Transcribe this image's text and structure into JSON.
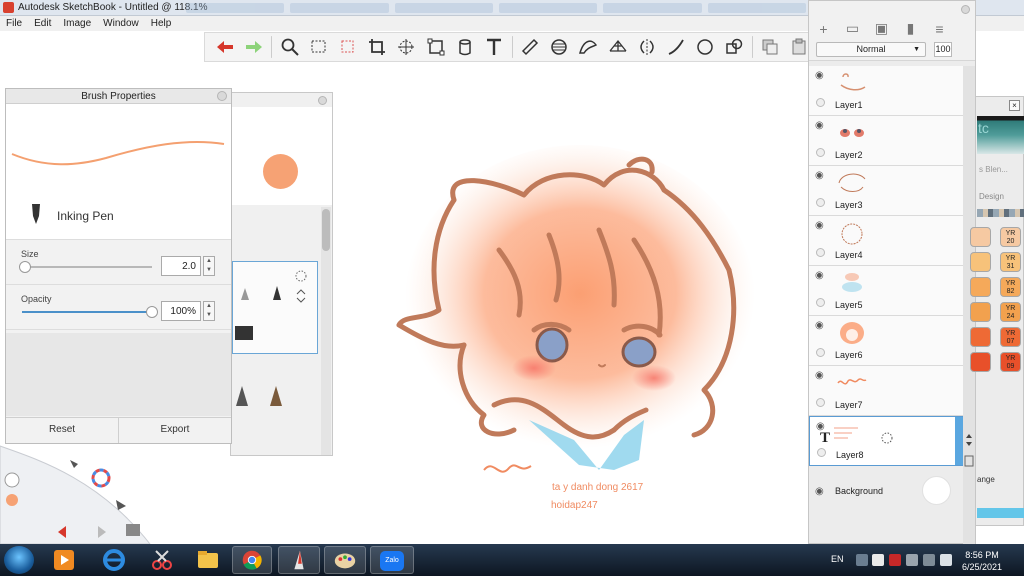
{
  "window": {
    "title": "Autodesk SketchBook - Untitled @ 118.1%"
  },
  "menu": [
    "File",
    "Edit",
    "Image",
    "Window",
    "Help"
  ],
  "toolbar": {
    "tools": [
      "undo-icon",
      "redo-icon",
      "zoom-icon",
      "rect-select-icon",
      "lasso-select-icon",
      "crop-icon",
      "transform-icon",
      "distort-icon",
      "fill-icon",
      "text-icon",
      "ruler-icon",
      "ellipse-guide-icon",
      "french-curve-icon",
      "perspective-icon",
      "symmetry-icon",
      "line-icon",
      "circle-icon",
      "shapes-icon",
      "copy-icon",
      "paste-icon"
    ]
  },
  "brush_properties": {
    "title": "Brush Properties",
    "brush_name": "Inking Pen",
    "size_label": "Size",
    "size_value": "2.0",
    "size_fraction": 0.02,
    "opacity_label": "Opacity",
    "opacity_value": "100%",
    "opacity_fraction": 1.0,
    "reset_label": "Reset",
    "export_label": "Export",
    "stroke_color": "#f4a070"
  },
  "color_panel": {
    "current_color": "#f6a274"
  },
  "layers": {
    "blend_mode": "Normal",
    "opacity": "100",
    "items": [
      {
        "name": "Layer1",
        "selected": false
      },
      {
        "name": "Layer2",
        "selected": false
      },
      {
        "name": "Layer3",
        "selected": false
      },
      {
        "name": "Layer4",
        "selected": false
      },
      {
        "name": "Layer5",
        "selected": false
      },
      {
        "name": "Layer6",
        "selected": false
      },
      {
        "name": "Layer7",
        "selected": false
      },
      {
        "name": "Layer8",
        "selected": true
      }
    ],
    "background_label": "Background"
  },
  "copic_panel": {
    "header_text": "tc",
    "blend_text": "s Blen...",
    "design_text": "Design",
    "change_text": "ange",
    "swatches": [
      {
        "label": "YR\n20",
        "color": "#f6c9a2"
      },
      {
        "label": "YR\n31",
        "color": "#f7c27a"
      },
      {
        "label": "YR\n82",
        "color": "#f5a95a"
      },
      {
        "label": "YR\n24",
        "color": "#f2a14e"
      },
      {
        "label": "YR\n07",
        "color": "#ee6a35"
      },
      {
        "label": "YR\n09",
        "color": "#e8502a"
      }
    ]
  },
  "canvas": {
    "signature_name": "ta y danh dong 2617",
    "signature_user": "hoidap247"
  },
  "taskbar": {
    "language": "EN",
    "time": "8:56 PM",
    "date": "6/25/2021",
    "apps": [
      "windows-explorer-icon",
      "media-player-icon",
      "internet-explorer-icon",
      "snipping-tool-icon",
      "file-explorer-icon",
      "chrome-icon",
      "sketchbook-icon",
      "paint-icon",
      "zalo-icon"
    ],
    "zalo_label": "Zalo"
  }
}
